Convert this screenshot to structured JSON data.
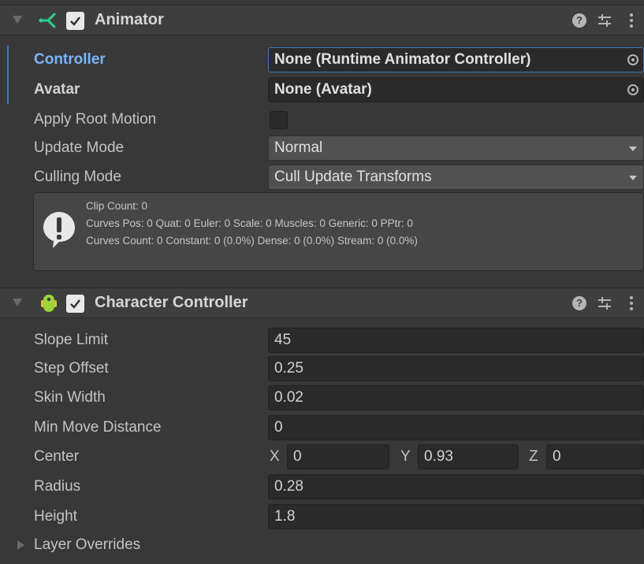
{
  "animator": {
    "title": "Animator",
    "enabled": true,
    "controller": {
      "label": "Controller",
      "value": "None (Runtime Animator Controller)"
    },
    "avatar": {
      "label": "Avatar",
      "value": "None (Avatar)"
    },
    "apply_root_motion": {
      "label": "Apply Root Motion",
      "checked": false
    },
    "update_mode": {
      "label": "Update Mode",
      "value": "Normal"
    },
    "culling_mode": {
      "label": "Culling Mode",
      "value": "Cull Update Transforms"
    },
    "info": {
      "line1": "Clip Count: 0",
      "line2": "Curves Pos: 0 Quat: 0 Euler: 0 Scale: 0 Muscles: 0 Generic: 0 PPtr: 0",
      "line3": "Curves Count: 0 Constant: 0 (0.0%) Dense: 0 (0.0%) Stream: 0 (0.0%)"
    }
  },
  "character_controller": {
    "title": "Character Controller",
    "enabled": true,
    "slope_limit": {
      "label": "Slope Limit",
      "value": "45"
    },
    "step_offset": {
      "label": "Step Offset",
      "value": "0.25"
    },
    "skin_width": {
      "label": "Skin Width",
      "value": "0.02"
    },
    "min_move_distance": {
      "label": "Min Move Distance",
      "value": "0"
    },
    "center": {
      "label": "Center",
      "x_label": "X",
      "x": "0",
      "y_label": "Y",
      "y": "0.93",
      "z_label": "Z",
      "z": "0"
    },
    "radius": {
      "label": "Radius",
      "value": "0.28"
    },
    "height": {
      "label": "Height",
      "value": "1.8"
    },
    "layer_overrides": {
      "label": "Layer Overrides"
    }
  },
  "icons": {
    "help": "help-icon",
    "presets": "presets-icon",
    "kebab": "kebab-menu-icon",
    "animator": "animator-component-icon",
    "character_controller": "character-controller-icon",
    "warning": "info-icon",
    "object_picker": "object-picker-icon"
  },
  "colors": {
    "background": "#383838",
    "header": "#3e3e3e",
    "field": "#2a2a2a",
    "highlight_label": "#7ab5f5",
    "animator_icon": "#2bd18e",
    "controller_icon": "#9ad43a"
  }
}
